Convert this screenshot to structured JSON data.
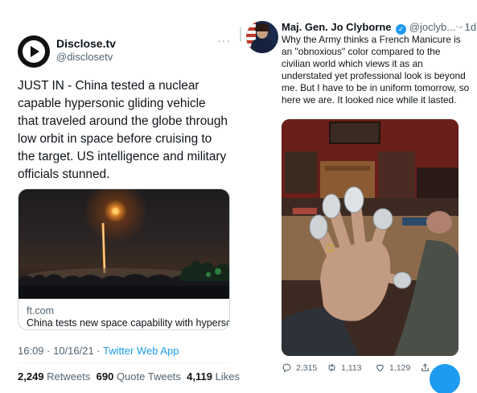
{
  "left_tweet": {
    "author_name": "Disclose.tv",
    "author_handle": "@disclosetv",
    "more": "···",
    "text": "JUST IN - China tested a nuclear capable hypersonic gliding vehicle that traveled around the globe through low orbit in space before cruising to the target. US intelligence and military officials stunned.",
    "card": {
      "domain": "ft.com",
      "title": "China tests new space capability with hyperso..."
    },
    "meta": {
      "time_date": "16:09 · 10/16/21 · ",
      "source": "Twitter Web App"
    },
    "stats": {
      "retweets_count": "2,249",
      "retweets_label": "Retweets",
      "quotes_count": "690",
      "quotes_label": "Quote Tweets",
      "likes_count": "4,119",
      "likes_label": "Likes"
    }
  },
  "right_tweet": {
    "author_name": "Maj. Gen. Jo Clyborne",
    "verified_badge": "✓",
    "author_handle": "@joclyb...",
    "time": "· 1d",
    "more": "···",
    "text": "Why the Army thinks a French Manicure is an \"obnoxious\" color compared to the civilian world which views it as an understated yet professional look is beyond me. But I have to be in uniform tomorrow, so here we are. It looked nice while it lasted.",
    "actions": {
      "replies": "2,315",
      "retweets": "1,113",
      "likes": "1,129"
    }
  },
  "colors": {
    "accent": "#1d9bf0",
    "secondary_text": "#536471",
    "primary_text": "#0f1419",
    "border": "#cfd9de"
  },
  "icons": [
    "play-logo-icon",
    "verified-badge-icon",
    "reply-icon",
    "retweet-icon",
    "like-icon",
    "share-icon"
  ]
}
